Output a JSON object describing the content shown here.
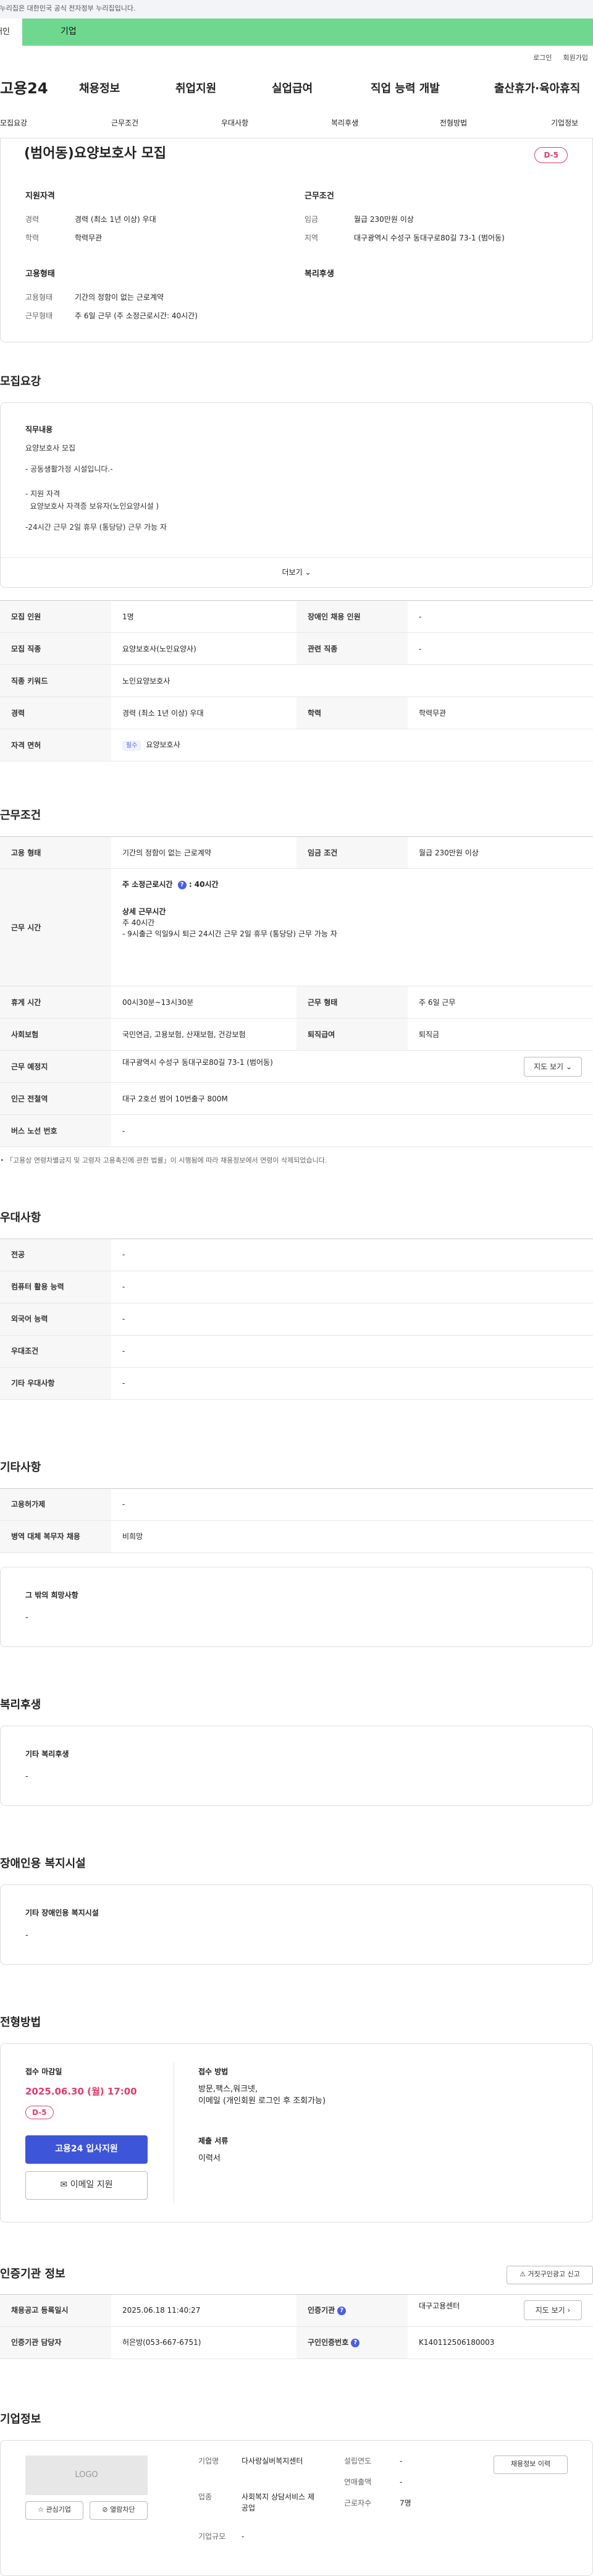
{
  "gov_bar": {
    "text": "이 누리집은 대한민국 공식 전자정부 누리집입니다."
  },
  "tabs": {
    "personal": "개인",
    "company": "기업"
  },
  "util": {
    "login": "로그인",
    "signup": "회원가입"
  },
  "gnb": {
    "logo": "고용24",
    "menu": [
      "채용정보",
      "취업지원",
      "실업급여",
      "직업 능력 개발",
      "출산휴가·육아휴직"
    ]
  },
  "subnav": [
    "모집요강",
    "근무조건",
    "우대사항",
    "복리후생",
    "전형방법",
    "기업정보"
  ],
  "summary": {
    "title": "(범어동)요양보호사 모집",
    "dday": "D-5",
    "qual_heading": "지원자격",
    "cond_heading": "근무조건",
    "emp_heading": "고용형태",
    "welfare_heading": "복리후생",
    "rows_left": [
      {
        "label": "경력",
        "value": "경력 (최소 1년 이상) 우대"
      },
      {
        "label": "학력",
        "value": "학력무관"
      }
    ],
    "rows_right": [
      {
        "label": "임금",
        "value": "월급 230만원 이상"
      },
      {
        "label": "지역",
        "value": "대구광역시 수성구 동대구로80길 73-1 (범어동)"
      }
    ],
    "emp_rows": [
      {
        "label": "고용형태",
        "value": "기간의 정함이 없는 근로계약"
      },
      {
        "label": "근무형태",
        "value": "주 6일 근무 (주 소정근로시간: 40시간)"
      }
    ]
  },
  "recruit": {
    "heading": "모집요강",
    "duty_heading": "직무내용",
    "duty_lines": [
      "요양보호사  모집",
      "- 공동생활가정 시설입니다.-",
      "- 지원 자격",
      "  요양보호사 자격증 보유자(노인요양시설 )",
      "-24시간 근무 2일 휴무 (통당당) 근무 가능 자"
    ],
    "more": "더보기",
    "table": [
      {
        "l1": "모집 인원",
        "v1": "1명",
        "l2": "장애인 채용 인원",
        "v2": "-"
      },
      {
        "l1": "모집 직종",
        "v1": "요양보호사(노인요양사)",
        "l2": "관련 직종",
        "v2": "-"
      },
      {
        "l1": "직종 키워드",
        "v1": "노인요양보호사",
        "l2": "",
        "v2": ""
      },
      {
        "l1": "경력",
        "v1": "경력 (최소 1년 이상) 우대",
        "l2": "학력",
        "v2": "학력무관"
      },
      {
        "l1": "자격 면허",
        "v1": "요양보호사",
        "l2": "",
        "v2": ""
      }
    ],
    "license_tag": "필수"
  },
  "condition": {
    "heading": "근무조건",
    "emp_label": "고용 형태",
    "emp_value": "기간의 정함이 없는 근로계약",
    "wage_label": "임금 조건",
    "wage_value": "월급 230만원 이상",
    "time_label": "근무 시간",
    "time_line1": "주 소정근로시간 ",
    "time_line1b": "40시간",
    "time_detail_heading": "상세 근무시간",
    "time_detail": [
      "주 40시간",
      "- 9시출근 익일9시 퇴근 24시간 근무 2일 휴무 (통당당) 근무 가능 자"
    ],
    "break_label": "휴게 시간",
    "break_value": "00시30분~13시30분",
    "form_label": "근무 형태",
    "form_value": "주 6일 근무",
    "insurance_label": "사회보험",
    "insurance_value": "국민연금, 고용보험, 산재보험, 건강보험",
    "severance_label": "퇴직급여",
    "severance_value": "퇴직금",
    "place_label": "근무 예정지",
    "place_value": "대구광역시 수성구 동대구로80길 73-1 (범어동)",
    "map_button": "지도 보기",
    "subway_label": "인근 전철역",
    "subway_value": "대구 2호선 범어 10번출구 800M",
    "bus_label": "버스 노선 번호",
    "bus_value": "-",
    "note": "「고용상 연령차별금지 및 고령자 고용촉진에 관한 법률」이 시행됨에 따라 채용정보에서 연령이 삭제되었습니다."
  },
  "preference": {
    "heading": "우대사항",
    "rows": [
      {
        "label": "전공",
        "value": "-"
      },
      {
        "label": "컴퓨터 활용 능력",
        "value": "-"
      },
      {
        "label": "외국어 능력",
        "value": "-"
      },
      {
        "label": "우대조건",
        "value": "-"
      },
      {
        "label": "기타 우대사항",
        "value": "-"
      }
    ]
  },
  "etc": {
    "heading": "기타사항",
    "rows": [
      {
        "label": "고용허가제",
        "value": "-"
      },
      {
        "label": "병역 대체 복무자 채용",
        "value": "비희망"
      }
    ],
    "hope_heading": "그 밖의 희망사항",
    "hope_value": "-"
  },
  "welfare": {
    "heading": "복리후생",
    "sub": "기타 복리후생",
    "value": "-"
  },
  "disabled": {
    "heading": "장애인용 복지시설",
    "sub": "기타 장애인용 복지시설",
    "value": "-"
  },
  "process": {
    "heading": "전형방법",
    "deadline_heading": "접수 마감일",
    "deadline": "2025.06.30 (월) 17:00",
    "dday": "D-5",
    "apply_button": "고용24 입사지원",
    "email_button": "이메일 지원",
    "method_heading": "접수 방법",
    "method_value": "방문,팩스,워크넷,",
    "method_value2": "이메일 (개인회원 로그인 후 조회가능)",
    "docs_heading": "제출 서류",
    "docs_value": "이력서"
  },
  "agency": {
    "heading": "인증기관 정보",
    "report_button": "거짓구인광고 신고",
    "rows": [
      {
        "l1": "채용공고 등록일시",
        "v1": "2025.06.18 11:40:27",
        "l2": "인증기관",
        "v2": "대구고용센터",
        "btn": "지도 보기"
      },
      {
        "l1": "인증기관 담당자",
        "v1": "허은방(053-667-6751)",
        "l2": "구인인증번호",
        "v2": "K140112506180003",
        "btn": ""
      }
    ]
  },
  "company": {
    "heading": "기업정보",
    "logo": "LOGO",
    "fav_button": "관심기업",
    "block_button": "열람차단",
    "name_label": "기업명",
    "name_value": "다사랑실버복지센터",
    "industry_label": "업종",
    "industry_value": "사회복지 상담서비스 제공업",
    "size_label": "기업규모",
    "size_value": "-",
    "founded_label": "설립연도",
    "founded_value": "-",
    "sales_label": "연매출액",
    "sales_value": "-",
    "workers_label": "근로자수",
    "workers_value": "7명",
    "more_button": "채용정보 이력"
  }
}
